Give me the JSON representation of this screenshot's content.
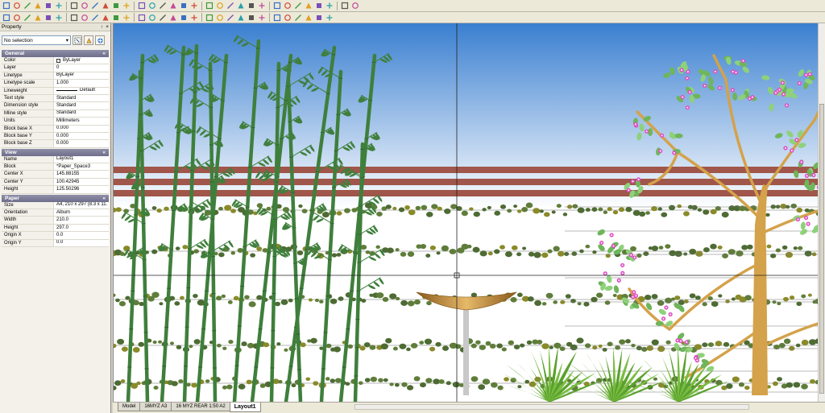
{
  "toolbar_row1": {
    "icons": [
      "new-icon",
      "open-icon",
      "save-icon",
      "print-icon",
      "add-icon",
      "preview-icon",
      "cut-icon",
      "copy-icon",
      "paste-icon",
      "undo-icon",
      "redo-icon",
      "zoom-in-icon",
      "zoom-out-icon",
      "zoom-window-icon",
      "zoom-extents-icon",
      "zoom-previous-icon",
      "pan-icon",
      "regen-icon",
      "layer-icon",
      "properties-icon",
      "layer-manager-icon",
      "hatch-icon",
      "block-icon",
      "text-style-icon",
      "dim-style-icon",
      "color-palette-icon",
      "layer-states-icon",
      "linetype-icon",
      "text-icon",
      "insert-image-icon",
      "plot-icon",
      "help-icon"
    ]
  },
  "toolbar_row2": {
    "icons": [
      "line-icon",
      "polyline-icon",
      "arc-icon",
      "circle-icon",
      "rectangle-icon",
      "ellipse-icon",
      "spline-icon",
      "point-icon",
      "hatch-icon",
      "region-icon",
      "move-icon",
      "copy-object-icon",
      "rotate-icon",
      "scale-icon",
      "mirror-icon",
      "offset-icon",
      "trim-icon",
      "extend-icon",
      "fillet-icon",
      "dim-linear-icon",
      "dim-aligned-icon",
      "dim-radius-icon",
      "snap-icon",
      "grid-icon",
      "ortho-icon",
      "polar-icon",
      "osnap-icon",
      "otrack-icon",
      "lineweight-icon",
      "model-space-icon"
    ]
  },
  "panel": {
    "title": "Property",
    "pin_label": "↑",
    "close_label": "×",
    "selection": "No selection",
    "sections": [
      {
        "title": "General",
        "rows": [
          {
            "key": "Color",
            "value": "ByLayer",
            "swatch": true
          },
          {
            "key": "Layer",
            "value": "0"
          },
          {
            "key": "Linetype",
            "value": "ByLayer"
          },
          {
            "key": "Linetype scale",
            "value": "1.000"
          },
          {
            "key": "Lineweight",
            "value": "Default",
            "lineweight": true
          },
          {
            "key": "Text style",
            "value": "Standard"
          },
          {
            "key": "Dimension style",
            "value": "Standard"
          },
          {
            "key": "Mline style",
            "value": "Standard"
          },
          {
            "key": "Units",
            "value": "Millimeters"
          },
          {
            "key": "Block base X",
            "value": "0.000"
          },
          {
            "key": "Block base Y",
            "value": "0.000"
          },
          {
            "key": "Block base Z",
            "value": "0.000"
          }
        ]
      },
      {
        "title": "View",
        "rows": [
          {
            "key": "Name",
            "value": "Layout1"
          },
          {
            "key": "Block",
            "value": "*Paper_Space3"
          },
          {
            "key": "Center X",
            "value": "145.88155"
          },
          {
            "key": "Center Y",
            "value": "100.42945"
          },
          {
            "key": "Height",
            "value": "125.50296"
          }
        ]
      },
      {
        "title": "Paper",
        "rows": [
          {
            "key": "Size",
            "value": "A4, 210 x 297 (8.3 x 11."
          },
          {
            "key": "Orientation",
            "value": "Album"
          },
          {
            "key": "Width",
            "value": "210.0"
          },
          {
            "key": "Height",
            "value": "297.0"
          },
          {
            "key": "Origin X",
            "value": "0.0"
          },
          {
            "key": "Origin Y",
            "value": "0.0"
          }
        ]
      }
    ]
  },
  "tabs": [
    {
      "label": "Model",
      "active": false
    },
    {
      "label": "16MYZ A3",
      "active": false
    },
    {
      "label": "16 MYZ REAR 1:50 A2",
      "active": false
    },
    {
      "label": "Layout1",
      "active": true
    }
  ],
  "colors": {
    "sky_top": "#3a7fd0",
    "sky_bottom": "#ffffff",
    "fence": "#a0564a",
    "bamboo": "#3f7f3c",
    "vine": "#4d6b33",
    "tree": "#d4a24a",
    "blossom": "#e04fc4",
    "leaf_light": "#8ed17a",
    "fern": "#5aa02c",
    "birdbath": "#c9964a"
  }
}
